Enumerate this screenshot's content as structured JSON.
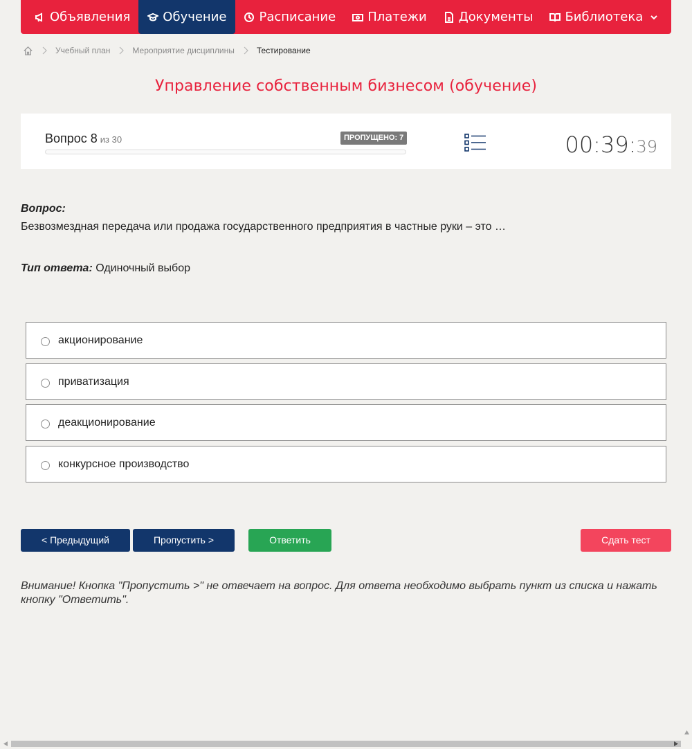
{
  "nav": {
    "items": [
      {
        "label": "Объявления",
        "icon": "megaphone-icon"
      },
      {
        "label": "Обучение",
        "icon": "graduation-cap-icon"
      },
      {
        "label": "Расписание",
        "icon": "clock-icon"
      },
      {
        "label": "Платежи",
        "icon": "money-icon"
      },
      {
        "label": "Документы",
        "icon": "document-icon"
      },
      {
        "label": "Библиотека",
        "icon": "book-icon"
      }
    ],
    "active_index": 1
  },
  "breadcrumb": {
    "items": [
      "Учебный план",
      "Мероприятие дисциплины",
      "Тестирование"
    ]
  },
  "page_title": "Управление собственным бизнесом (обучение)",
  "quiz": {
    "question_label": "Вопрос 8",
    "question_of": "из 30",
    "skipped_badge": "ПРОПУЩЕНО: 7",
    "progress_fraction": 0,
    "timer": {
      "hm": "00:39:",
      "sec": "39"
    }
  },
  "question": {
    "heading": "Вопрос:",
    "text": "Безвозмездная передача или продажа государственного предприятия в частные руки – это …",
    "answer_type_label": "Тип ответа:",
    "answer_type_value": "Одиночный выбор"
  },
  "options": [
    "акционирование",
    "приватизация",
    "деакционирование",
    "конкурсное производство"
  ],
  "buttons": {
    "prev": "< Предыдущий",
    "skip": "Пропустить >",
    "answer": "Ответить",
    "finish": "Сдать тест"
  },
  "warning": "Внимание! Кнопка \"Пропустить >\" не отвечает на вопрос. Для ответа необходимо выбрать пункт из списка и нажать кнопку \"Ответить\".",
  "colors": {
    "brand_red": "#e8223d",
    "navy": "#12366b",
    "green": "#28a554",
    "finish_red": "#f3455d",
    "background": "#f2f1ee"
  }
}
